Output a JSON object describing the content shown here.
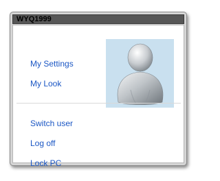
{
  "window": {
    "title": "WYQ1999"
  },
  "menu": {
    "my_settings": "My Settings",
    "my_look": "My Look",
    "switch_user": "Switch user",
    "log_off": "Log off",
    "lock_pc": "Lock PC"
  },
  "avatar": {
    "icon": "user-avatar-icon",
    "background": "#c9e0ef"
  }
}
